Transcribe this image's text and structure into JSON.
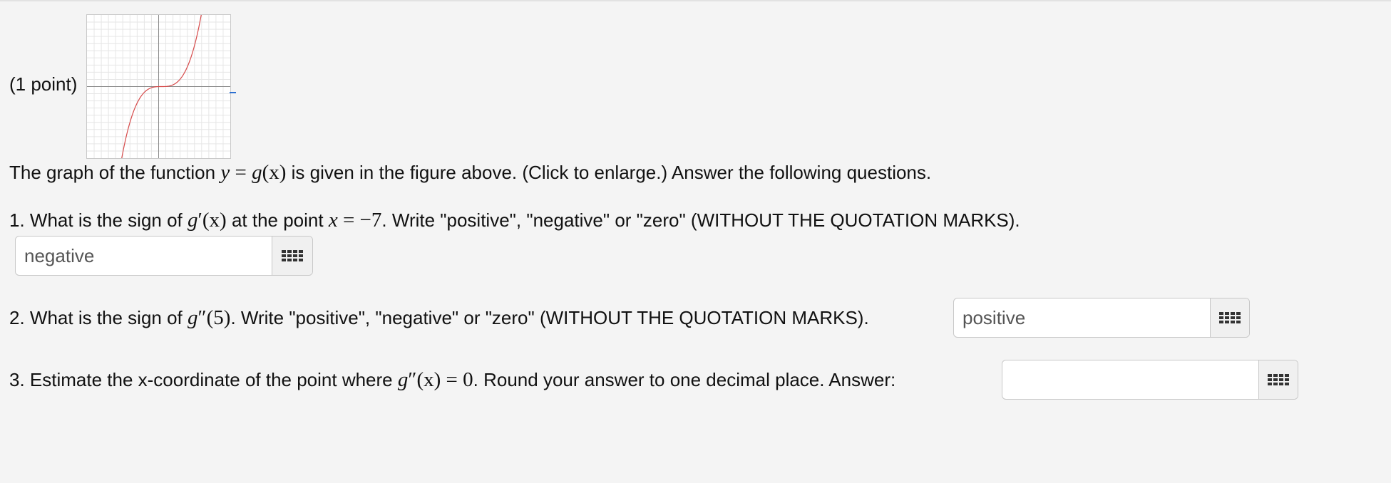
{
  "problem": {
    "points_label": "(1 point)",
    "figure": {
      "alt": "Click to enlarge",
      "curve_color": "#d64a4a"
    },
    "intro": {
      "before": "The graph of the function",
      "math_y": "y",
      "math_eq": " = ",
      "math_g": "g",
      "math_arg": "(x)",
      "after": "is given in the figure above. (Click to enlarge.) Answer the following questions."
    },
    "q1": {
      "text_a": "1. What is the sign of",
      "math_g": "g",
      "math_prime": "′",
      "math_arg": "(x)",
      "text_b": "at the point",
      "math_x": "x",
      "math_val": " = −7",
      "text_c": ". Write \"positive\", \"negative\" or \"zero\" (WITHOUT THE QUOTATION MARKS).",
      "answer_value": "negative"
    },
    "q2": {
      "text_a": "2. What is the sign of",
      "math_g": "g",
      "math_prime": "″",
      "math_arg": "(5)",
      "text_b": ". Write \"positive\", \"negative\" or \"zero\" (WITHOUT THE QUOTATION MARKS).",
      "answer_value": "positive"
    },
    "q3": {
      "text_a": "3. Estimate the x-coordinate of the point where",
      "math_g": "g",
      "math_prime": "″",
      "math_arg": "(x)",
      "math_eq": " = 0",
      "text_b": ". Round your answer to one decimal place. Answer:",
      "answer_value": ""
    },
    "keypad_icon": "grid-icon"
  }
}
